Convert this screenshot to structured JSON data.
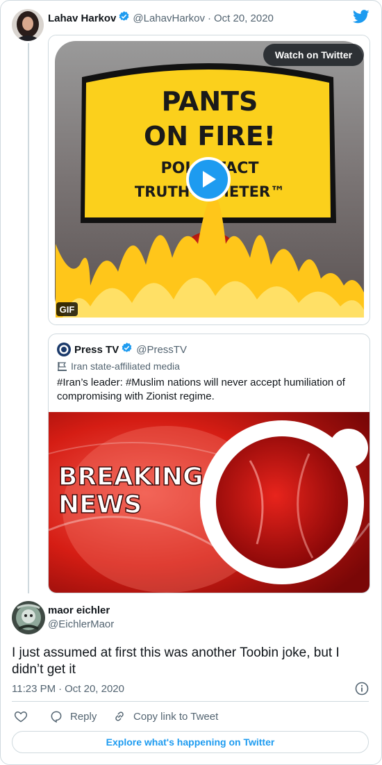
{
  "tweet": {
    "author_name": "Lahav Harkov",
    "author_handle": "@LahavHarkov",
    "date": "Oct 20, 2020",
    "media": {
      "watch_label": "Watch on Twitter",
      "gif_label": "GIF",
      "image_text": {
        "line1": "PANTS",
        "line2": "ON FIRE!",
        "line3": "POLITIFACT",
        "line4": "TRUTH-O-METER™"
      }
    }
  },
  "quoted": {
    "author_name": "Press TV",
    "author_handle": "@PressTV",
    "label": "Iran state-affiliated media",
    "text": "#Iran’s leader: #Muslim nations will never accept humiliation of compromising with Zionist regime.",
    "image_text": {
      "line1": "BREAKING",
      "line2": "NEWS"
    }
  },
  "reply": {
    "author_name": "maor eichler",
    "author_handle": "@EichlerMaor",
    "text": "I just assumed at first this was another Toobin joke, but I didn’t get it",
    "time": "11:23 PM",
    "date": "Oct 20, 2020",
    "actions": {
      "reply": "Reply",
      "copy_link": "Copy link to Tweet"
    },
    "explore": "Explore what's happening on Twitter"
  },
  "colors": {
    "twitter_blue": "#1d9bf0",
    "muted_text": "#536471",
    "border": "#cfd9de"
  }
}
